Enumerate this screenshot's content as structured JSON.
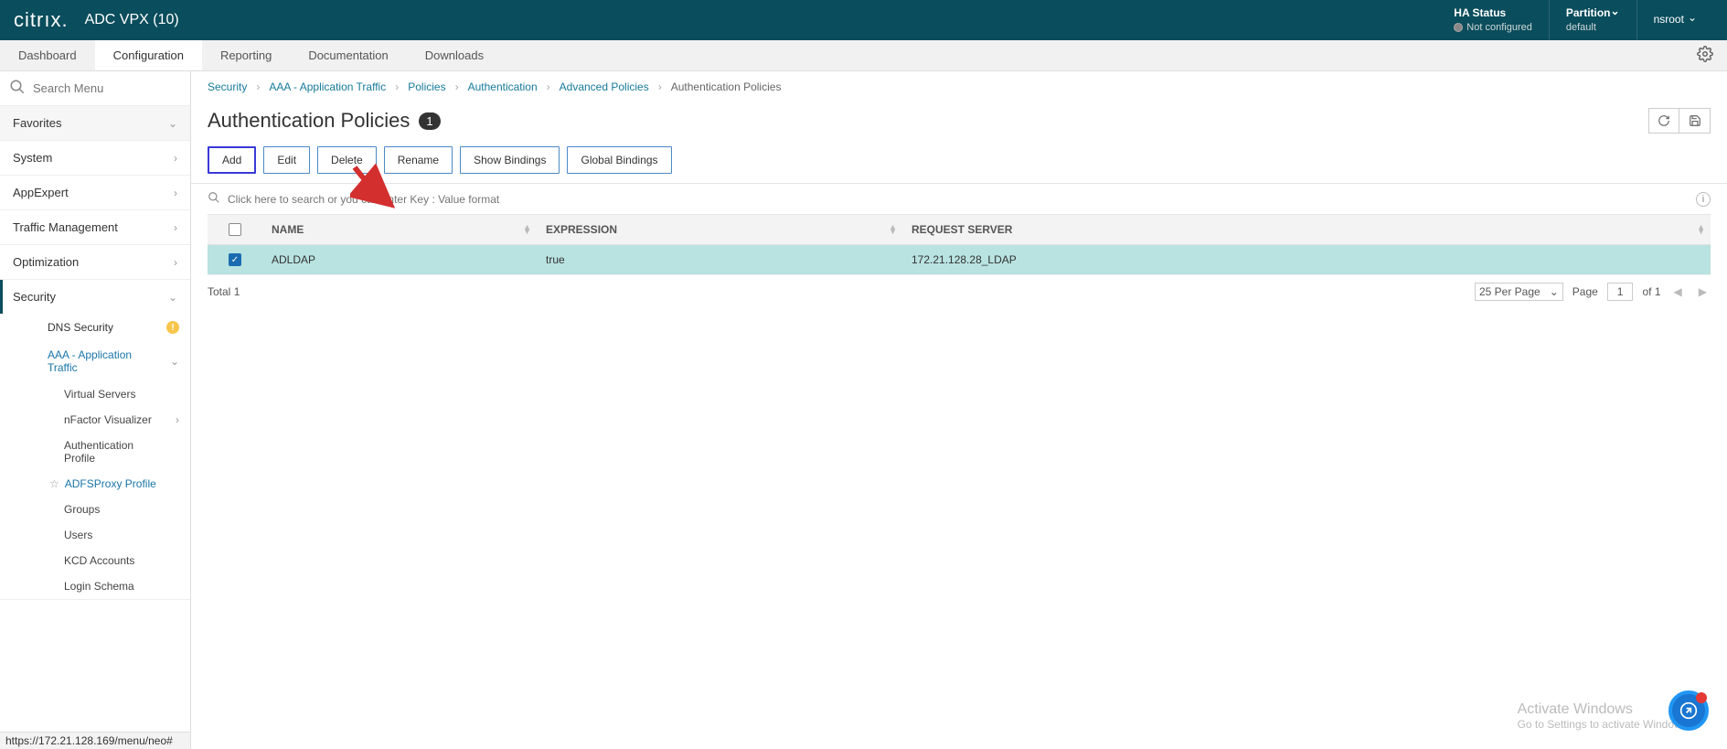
{
  "header": {
    "brand": "citrıx.",
    "app": "ADC VPX (10)",
    "ha_label": "HA Status",
    "ha_status": "Not configured",
    "partition_label": "Partition",
    "partition_value": "default",
    "user": "nsroot"
  },
  "navtabs": {
    "items": [
      "Dashboard",
      "Configuration",
      "Reporting",
      "Documentation",
      "Downloads"
    ],
    "active": "Configuration"
  },
  "sidebar": {
    "search_placeholder": "Search Menu",
    "favorites": "Favorites",
    "items": [
      {
        "label": "System"
      },
      {
        "label": "AppExpert"
      },
      {
        "label": "Traffic Management"
      },
      {
        "label": "Optimization"
      },
      {
        "label": "Security"
      }
    ],
    "security_children": [
      {
        "label": "DNS Security",
        "warn": true
      },
      {
        "label": "AAA - Application Traffic",
        "expanded": true
      }
    ],
    "aaa_children": [
      {
        "label": "Virtual Servers"
      },
      {
        "label": "nFactor Visualizer",
        "caret": true
      },
      {
        "label": "Authentication Profile"
      },
      {
        "label": "ADFSProxy Profile",
        "star": true,
        "link": true
      },
      {
        "label": "Groups"
      },
      {
        "label": "Users"
      },
      {
        "label": "KCD Accounts"
      },
      {
        "label": "Login Schema"
      }
    ]
  },
  "status_url": "https://172.21.128.169/menu/neo#",
  "breadcrumb": [
    {
      "label": "Security",
      "link": true
    },
    {
      "label": "AAA - Application Traffic",
      "link": true
    },
    {
      "label": "Policies",
      "link": true
    },
    {
      "label": "Authentication",
      "link": true
    },
    {
      "label": "Advanced Policies",
      "link": true
    },
    {
      "label": "Authentication Policies",
      "link": false
    }
  ],
  "page": {
    "title": "Authentication Policies",
    "count": "1"
  },
  "buttons": {
    "add": "Add",
    "edit": "Edit",
    "delete": "Delete",
    "rename": "Rename",
    "show_bindings": "Show Bindings",
    "global_bindings": "Global Bindings"
  },
  "filter": {
    "placeholder": "Click here to search or you can enter Key : Value format"
  },
  "table": {
    "headers": {
      "name": "NAME",
      "expression": "EXPRESSION",
      "request_server": "REQUEST SERVER"
    },
    "rows": [
      {
        "name": "ADLDAP",
        "expression": "true",
        "request_server": "172.21.128.28_LDAP",
        "selected": true
      }
    ],
    "total_label": "Total",
    "total": "1",
    "per_page": "25 Per Page",
    "page_label": "Page",
    "page": "1",
    "of_label": "of",
    "pages": "1"
  },
  "watermark": {
    "title": "Activate Windows",
    "sub": "Go to Settings to activate Windows."
  }
}
